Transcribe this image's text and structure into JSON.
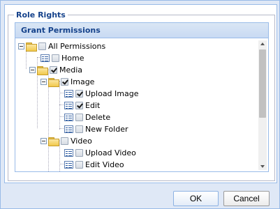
{
  "fieldset": {
    "legend": "Role Rights"
  },
  "tree": {
    "header": "Grant Permissions",
    "nodes": {
      "all": {
        "label": "All Permissions",
        "checked": false
      },
      "home": {
        "label": "Home",
        "checked": false
      },
      "media": {
        "label": "Media",
        "checked": true
      },
      "image": {
        "label": "Image",
        "checked": true
      },
      "upload_image": {
        "label": "Upload Image",
        "checked": true
      },
      "edit": {
        "label": "Edit",
        "checked": true
      },
      "delete": {
        "label": "Delete",
        "checked": false
      },
      "new_folder": {
        "label": "New Folder",
        "checked": false
      },
      "video": {
        "label": "Video",
        "checked": false
      },
      "upload_video": {
        "label": "Upload Video",
        "checked": false
      },
      "edit_video": {
        "label": "Edit Video",
        "checked": false
      }
    }
  },
  "buttons": {
    "ok": "OK",
    "cancel": "Cancel"
  },
  "icons": {
    "collapse": "collapse-icon",
    "folder": "folder-icon",
    "leaf": "permission-leaf-icon",
    "checkbox": "checkbox-icon",
    "scroll_up": "scroll-up-arrow-icon",
    "scroll_down": "scroll-down-arrow-icon"
  }
}
